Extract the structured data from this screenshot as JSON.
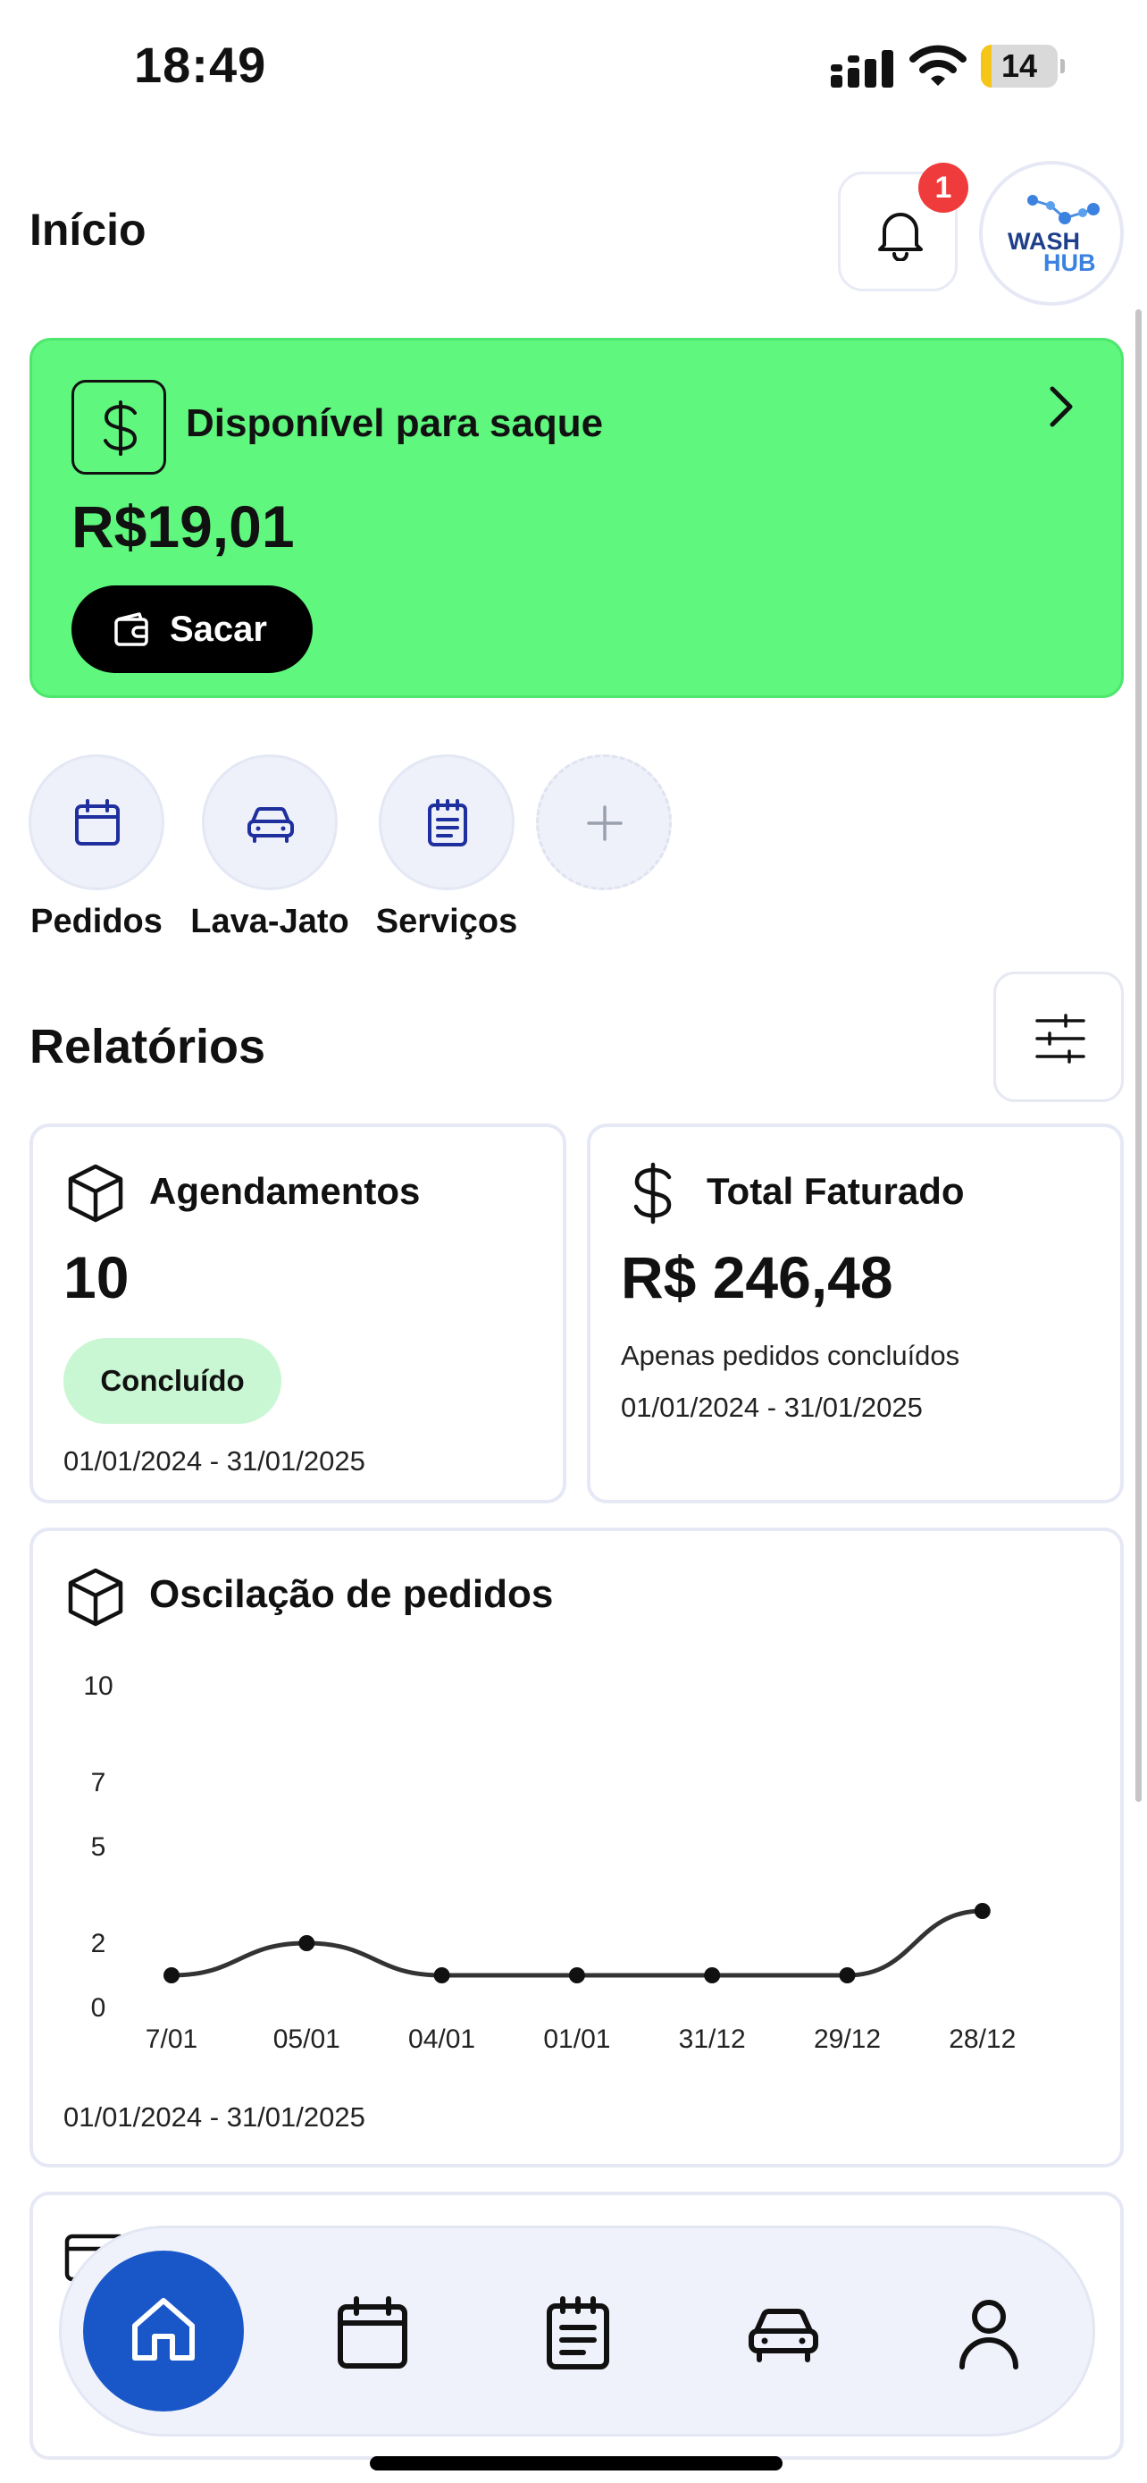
{
  "status_bar": {
    "time": "18:49",
    "battery": "14",
    "battery_level_percent": 14
  },
  "header": {
    "title": "Início",
    "notification_count": "1",
    "logo_text_top": "WASH",
    "logo_text_bottom": "HUB"
  },
  "balance": {
    "label": "Disponível para saque",
    "value": "R$19,01",
    "button": "Sacar"
  },
  "quick_actions": [
    {
      "label": "Pedidos",
      "icon": "calendar-icon"
    },
    {
      "label": "Lava-Jato",
      "icon": "car-icon"
    },
    {
      "label": "Serviços",
      "icon": "notepad-icon"
    },
    {
      "label": "",
      "icon": "plus-icon"
    }
  ],
  "reports": {
    "title": "Relatórios",
    "appointments": {
      "title": "Agendamentos",
      "value": "10",
      "status": "Concluído",
      "date_range": "01/01/2024 - 31/01/2025"
    },
    "revenue": {
      "title": "Total Faturado",
      "value": "R$ 246,48",
      "note": "Apenas pedidos concluídos",
      "date_range": "01/01/2024 - 31/01/2025"
    }
  },
  "chart_card": {
    "title": "Oscilação de pedidos",
    "date_range": "01/01/2024 - 31/01/2025"
  },
  "chart_data": {
    "type": "line",
    "title": "Oscilação de pedidos",
    "categories": [
      "7/01",
      "05/01",
      "04/01",
      "01/01",
      "31/12",
      "29/12",
      "28/12"
    ],
    "values": [
      1,
      2,
      1,
      1,
      1,
      1,
      3
    ],
    "y_ticks": [
      "10",
      "7",
      "5",
      "2",
      "0"
    ],
    "ylim": [
      0,
      10
    ],
    "grid": false
  },
  "colors": {
    "accent_green": "#5ff77e",
    "primary_blue": "#1957c8",
    "badge_red": "#ef3b3b",
    "badge_green": "#c9f7d3"
  },
  "bottom_nav": [
    "home-icon",
    "calendar-icon",
    "notepad-icon",
    "car-icon",
    "user-icon"
  ]
}
